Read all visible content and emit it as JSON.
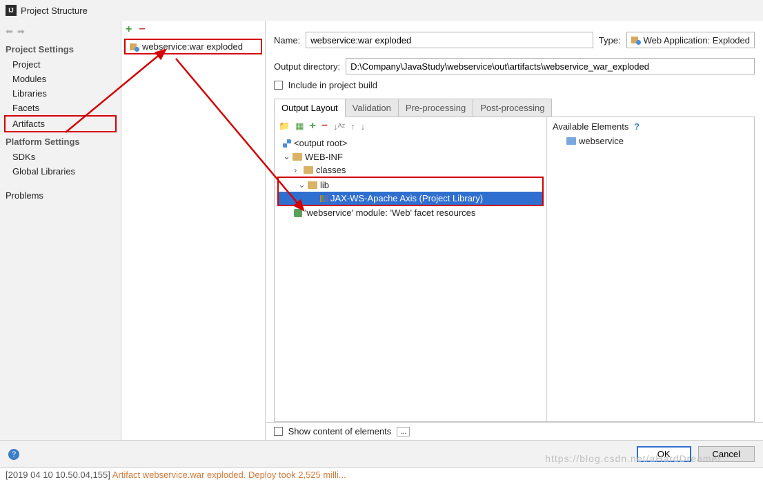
{
  "window": {
    "title": "Project Structure"
  },
  "sidebar": {
    "section1": "Project Settings",
    "section2": "Platform Settings",
    "items1": {
      "project": "Project",
      "modules": "Modules",
      "libraries": "Libraries",
      "facets": "Facets",
      "artifacts": "Artifacts"
    },
    "items2": {
      "sdks": "SDKs",
      "globalLibs": "Global Libraries"
    },
    "problems": "Problems"
  },
  "middle": {
    "artifact": "webservice:war exploded"
  },
  "form": {
    "nameLabel": "Name:",
    "nameValue": "webservice:war exploded",
    "typeLabel": "Type:",
    "typeValue": "Web Application: Exploded",
    "outDirLabel": "Output directory:",
    "outDirValue": "D:\\Company\\JavaStudy\\webservice\\out\\artifacts\\webservice_war_exploded",
    "includeLabel": "Include in project build"
  },
  "tabs": {
    "t0": "Output Layout",
    "t1": "Validation",
    "t2": "Pre-processing",
    "t3": "Post-processing"
  },
  "tree": {
    "root": "<output root>",
    "webinf": "WEB-INF",
    "classes": "classes",
    "lib": "lib",
    "jaxws": "JAX-WS-Apache Axis (Project Library)",
    "facet": "'webservice' module: 'Web' facet resources"
  },
  "avail": {
    "head": "Available Elements",
    "web": "webservice"
  },
  "bottom": {
    "show": "Show content of elements"
  },
  "buttons": {
    "ok": "OK",
    "cancel": "Cancel"
  },
  "console": {
    "gray": "[2019 04 10 10.50.04,155]",
    "rest": " Artifact webservice.war exploded. Deploy took 2,525 milli..."
  },
  "watermark": "https://blog.csdn.net/aHardDreamer"
}
